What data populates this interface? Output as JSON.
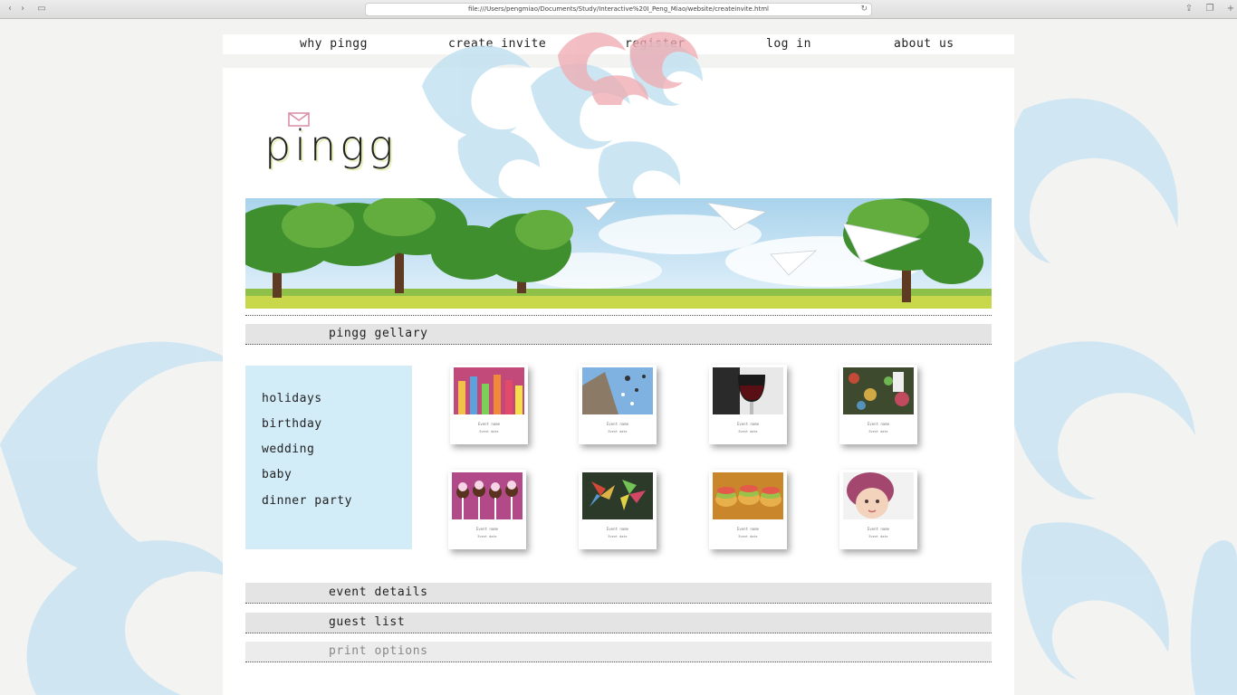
{
  "browser": {
    "url": "file:///Users/pengmiao/Documents/Study/Interactive%20I_Peng_Miao/website/createinvite.html"
  },
  "nav": {
    "items": [
      {
        "label": "why pingg"
      },
      {
        "label": "create invite"
      },
      {
        "label": "register"
      },
      {
        "label": "log in"
      },
      {
        "label": "about us"
      }
    ]
  },
  "logo": {
    "text": "pingg",
    "icon": "envelope-icon"
  },
  "gallery": {
    "title": "pingg gellary",
    "categories": [
      "holidays",
      "birthday",
      "wedding",
      "baby",
      "dinner party"
    ],
    "cards": [
      {
        "caption": "Event name",
        "sub": "Event date",
        "subject": "birthday candles"
      },
      {
        "caption": "Event name",
        "sub": "Event date",
        "subject": "building and balloons"
      },
      {
        "caption": "Event name",
        "sub": "Event date",
        "subject": "wine glass"
      },
      {
        "caption": "Event name",
        "sub": "Event date",
        "subject": "christmas lights"
      },
      {
        "caption": "Event name",
        "sub": "Event date",
        "subject": "cake pops"
      },
      {
        "caption": "Event name",
        "sub": "Event date",
        "subject": "pinwheels"
      },
      {
        "caption": "Event name",
        "sub": "Event date",
        "subject": "macarons"
      },
      {
        "caption": "Event name",
        "sub": "Event date",
        "subject": "baby in knit hat"
      }
    ]
  },
  "sections": {
    "event_details": "event details",
    "guest_list": "guest list",
    "print_options": "print options"
  },
  "colors": {
    "sidebar": "#d2ecf8",
    "swirl_blue": "#bfe0f0",
    "swirl_pink": "#f2b3b8",
    "section_bar": "#e4e4e4"
  }
}
